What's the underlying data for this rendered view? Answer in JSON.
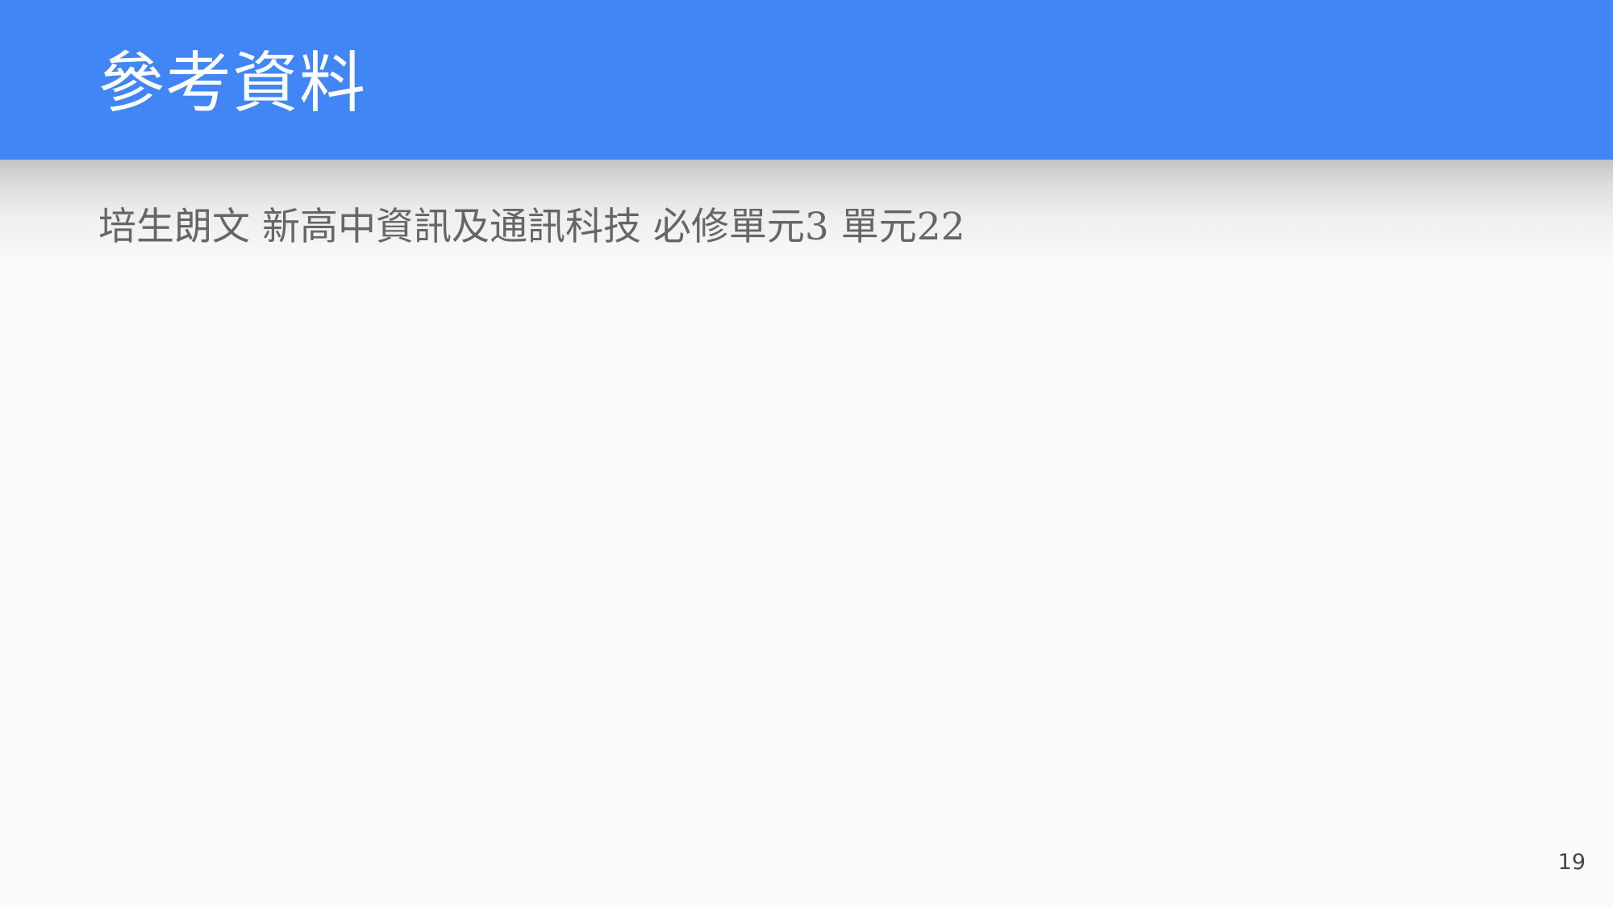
{
  "slide": {
    "title": "參考資料",
    "body": "培生朗文 新高中資訊及通訊科技 必修單元3 單元22",
    "page_number": "19"
  },
  "colors": {
    "title_bar": "#4285f4",
    "title_text": "#ffffff",
    "body_text": "#666666",
    "background": "#fafafa"
  }
}
